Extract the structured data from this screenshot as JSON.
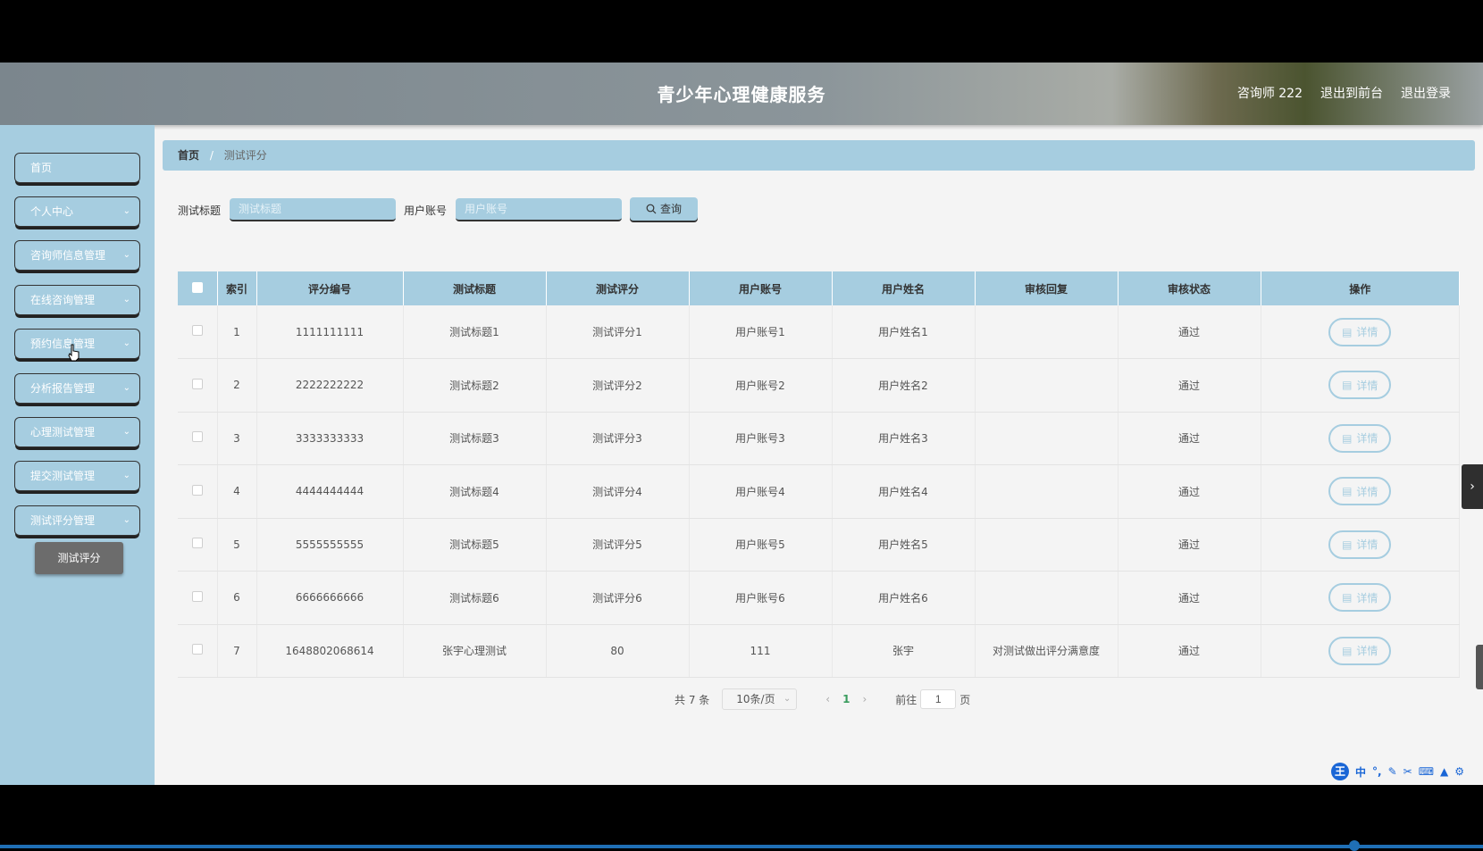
{
  "header": {
    "title": "青少年心理健康服务",
    "user": "咨询师 222",
    "front": "退出到前台",
    "logout": "退出登录"
  },
  "sidebar": {
    "items": [
      {
        "label": "首页"
      },
      {
        "label": "个人中心"
      },
      {
        "label": "咨询师信息管理"
      },
      {
        "label": "在线咨询管理"
      },
      {
        "label": "预约信息管理"
      },
      {
        "label": "分析报告管理"
      },
      {
        "label": "心理测试管理"
      },
      {
        "label": "提交测试管理"
      },
      {
        "label": "测试评分管理"
      }
    ],
    "submenu": "测试评分"
  },
  "breadcrumb": {
    "home": "首页",
    "sep": "/",
    "current": "测试评分"
  },
  "search": {
    "title_label": "测试标题",
    "title_placeholder": "测试标题",
    "account_label": "用户账号",
    "account_placeholder": "用户账号",
    "button": "查询"
  },
  "table": {
    "headers": [
      "索引",
      "评分编号",
      "测试标题",
      "测试评分",
      "用户账号",
      "用户姓名",
      "审核回复",
      "审核状态",
      "操作"
    ],
    "rows": [
      {
        "idx": "1",
        "no": "1111111111",
        "title": "测试标题1",
        "score": "测试评分1",
        "account": "用户账号1",
        "name": "用户姓名1",
        "reply": "",
        "status": "通过"
      },
      {
        "idx": "2",
        "no": "2222222222",
        "title": "测试标题2",
        "score": "测试评分2",
        "account": "用户账号2",
        "name": "用户姓名2",
        "reply": "",
        "status": "通过"
      },
      {
        "idx": "3",
        "no": "3333333333",
        "title": "测试标题3",
        "score": "测试评分3",
        "account": "用户账号3",
        "name": "用户姓名3",
        "reply": "",
        "status": "通过"
      },
      {
        "idx": "4",
        "no": "4444444444",
        "title": "测试标题4",
        "score": "测试评分4",
        "account": "用户账号4",
        "name": "用户姓名4",
        "reply": "",
        "status": "通过"
      },
      {
        "idx": "5",
        "no": "5555555555",
        "title": "测试标题5",
        "score": "测试评分5",
        "account": "用户账号5",
        "name": "用户姓名5",
        "reply": "",
        "status": "通过"
      },
      {
        "idx": "6",
        "no": "6666666666",
        "title": "测试标题6",
        "score": "测试评分6",
        "account": "用户账号6",
        "name": "用户姓名6",
        "reply": "",
        "status": "通过"
      },
      {
        "idx": "7",
        "no": "1648802068614",
        "title": "张宇心理测试",
        "score": "80",
        "account": "111",
        "name": "张宇",
        "reply": "对测试做出评分满意度",
        "status": "通过"
      }
    ],
    "action": "详情"
  },
  "pagination": {
    "total": "共 7 条",
    "size": "10条/页",
    "page": "1",
    "goto": "前往",
    "goto_value": "1",
    "unit": "页"
  },
  "ime": {
    "logo": "王",
    "lang": "中"
  },
  "colors": {
    "accent": "#a6cde0",
    "submenu": "#6c6c6c",
    "page_active": "#3a9c5e"
  }
}
